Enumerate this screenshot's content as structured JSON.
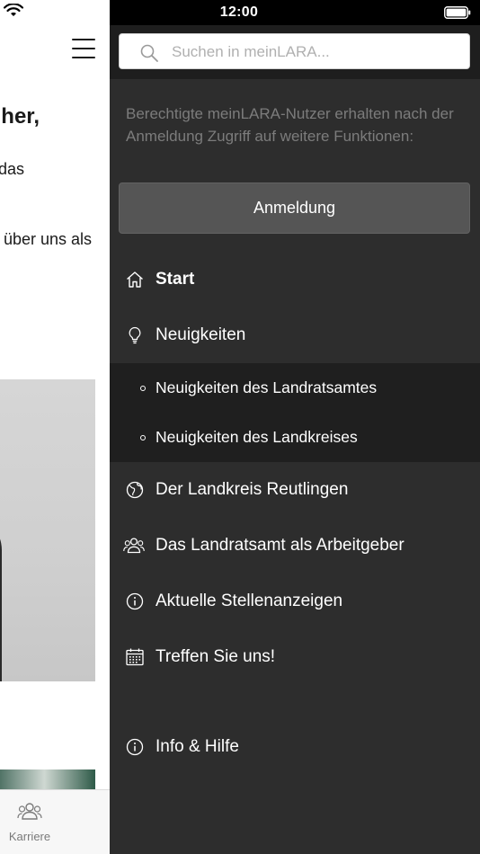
{
  "status_bar": {
    "time": "12:00"
  },
  "background_page": {
    "heading_fragment": "her,",
    "text_fragment_1": "das",
    "text_fragment_2": "über uns als",
    "tab_bar": {
      "karriere_label": "Karriere"
    }
  },
  "drawer": {
    "search": {
      "placeholder": "Suchen in meinLARA..."
    },
    "info_text": "Berechtigte meinLARA-Nutzer erhalten nach der Anmeldung Zugriff auf weitere Funktionen:",
    "login_button": "Anmeldung",
    "nav": {
      "start": {
        "label": "Start",
        "icon": "home-icon"
      },
      "neuigkeiten": {
        "label": "Neuigkeiten",
        "icon": "lightbulb-icon",
        "children": [
          {
            "label": "Neuigkeiten des Landratsamtes"
          },
          {
            "label": "Neuigkeiten des Landkreises"
          }
        ]
      },
      "landkreis": {
        "label": "Der Landkreis Reutlingen",
        "icon": "globe-icon"
      },
      "arbeitgeber": {
        "label": "Das Landratsamt als Arbeitgeber",
        "icon": "people-icon"
      },
      "stellen": {
        "label": "Aktuelle Stellenanzeigen",
        "icon": "info-icon"
      },
      "treffen": {
        "label": "Treffen Sie uns!",
        "icon": "calendar-icon"
      },
      "hilfe": {
        "label": "Info & Hilfe",
        "icon": "info-icon"
      }
    }
  },
  "colors": {
    "drawer_bg": "#2d2d2d",
    "submenu_bg": "#1f1f1f",
    "button_bg": "#555555",
    "info_text": "#7c7c7c"
  }
}
